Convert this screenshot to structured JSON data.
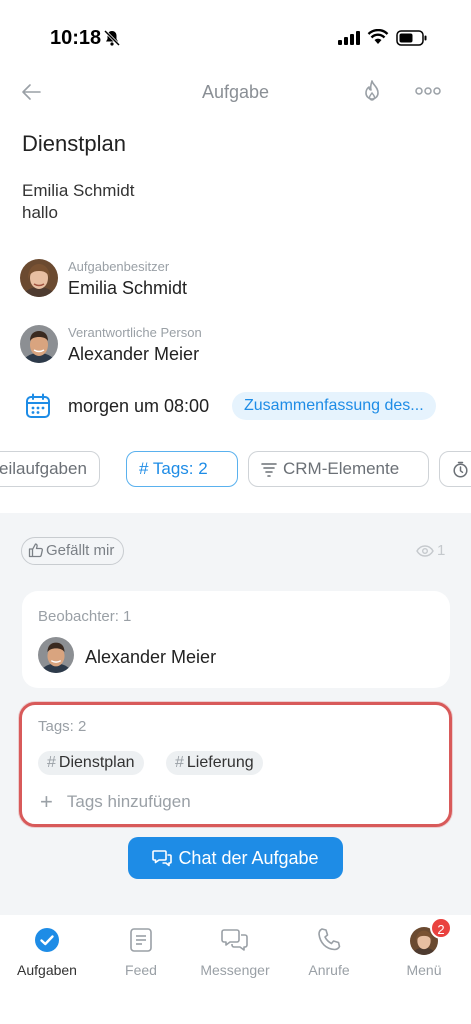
{
  "status_bar": {
    "time": "10:18"
  },
  "nav": {
    "title": "Aufgabe"
  },
  "task": {
    "title": "Dienstplan",
    "description_line1": "Emilia Schmidt",
    "description_line2": "hallo"
  },
  "owner": {
    "role": "Aufgabenbesitzer",
    "name": "Emilia Schmidt"
  },
  "responsible": {
    "role": "Verantwortliche Person",
    "name": "Alexander Meier"
  },
  "deadline": {
    "text": "morgen um 08:00",
    "summary_label": "Zusammenfassung des..."
  },
  "chips": {
    "subtasks": "eilaufgaben",
    "tags": "# Tags: 2",
    "crm": "CRM-Elemente"
  },
  "like_button": "Gefällt mir",
  "views_count": "1",
  "observers": {
    "label": "Beobachter: 1",
    "name": "Alexander Meier"
  },
  "tags_card": {
    "label": "Tags: 2",
    "tags": [
      "Dienstplan",
      "Lieferung"
    ],
    "add_label": "Tags hinzufügen"
  },
  "chat_button": "Chat der Aufgabe",
  "tabbar": {
    "items": [
      {
        "label": "Aufgaben",
        "icon": "check-circle-icon"
      },
      {
        "label": "Feed",
        "icon": "feed-icon"
      },
      {
        "label": "Messenger",
        "icon": "chat-bubbles-icon"
      },
      {
        "label": "Anrufe",
        "icon": "phone-icon"
      },
      {
        "label": "Menü",
        "icon": "avatar",
        "badge": "2"
      }
    ]
  },
  "colors": {
    "accent": "#1e8ce6",
    "highlight_border": "#d85a5a",
    "badge": "#e9423f"
  }
}
